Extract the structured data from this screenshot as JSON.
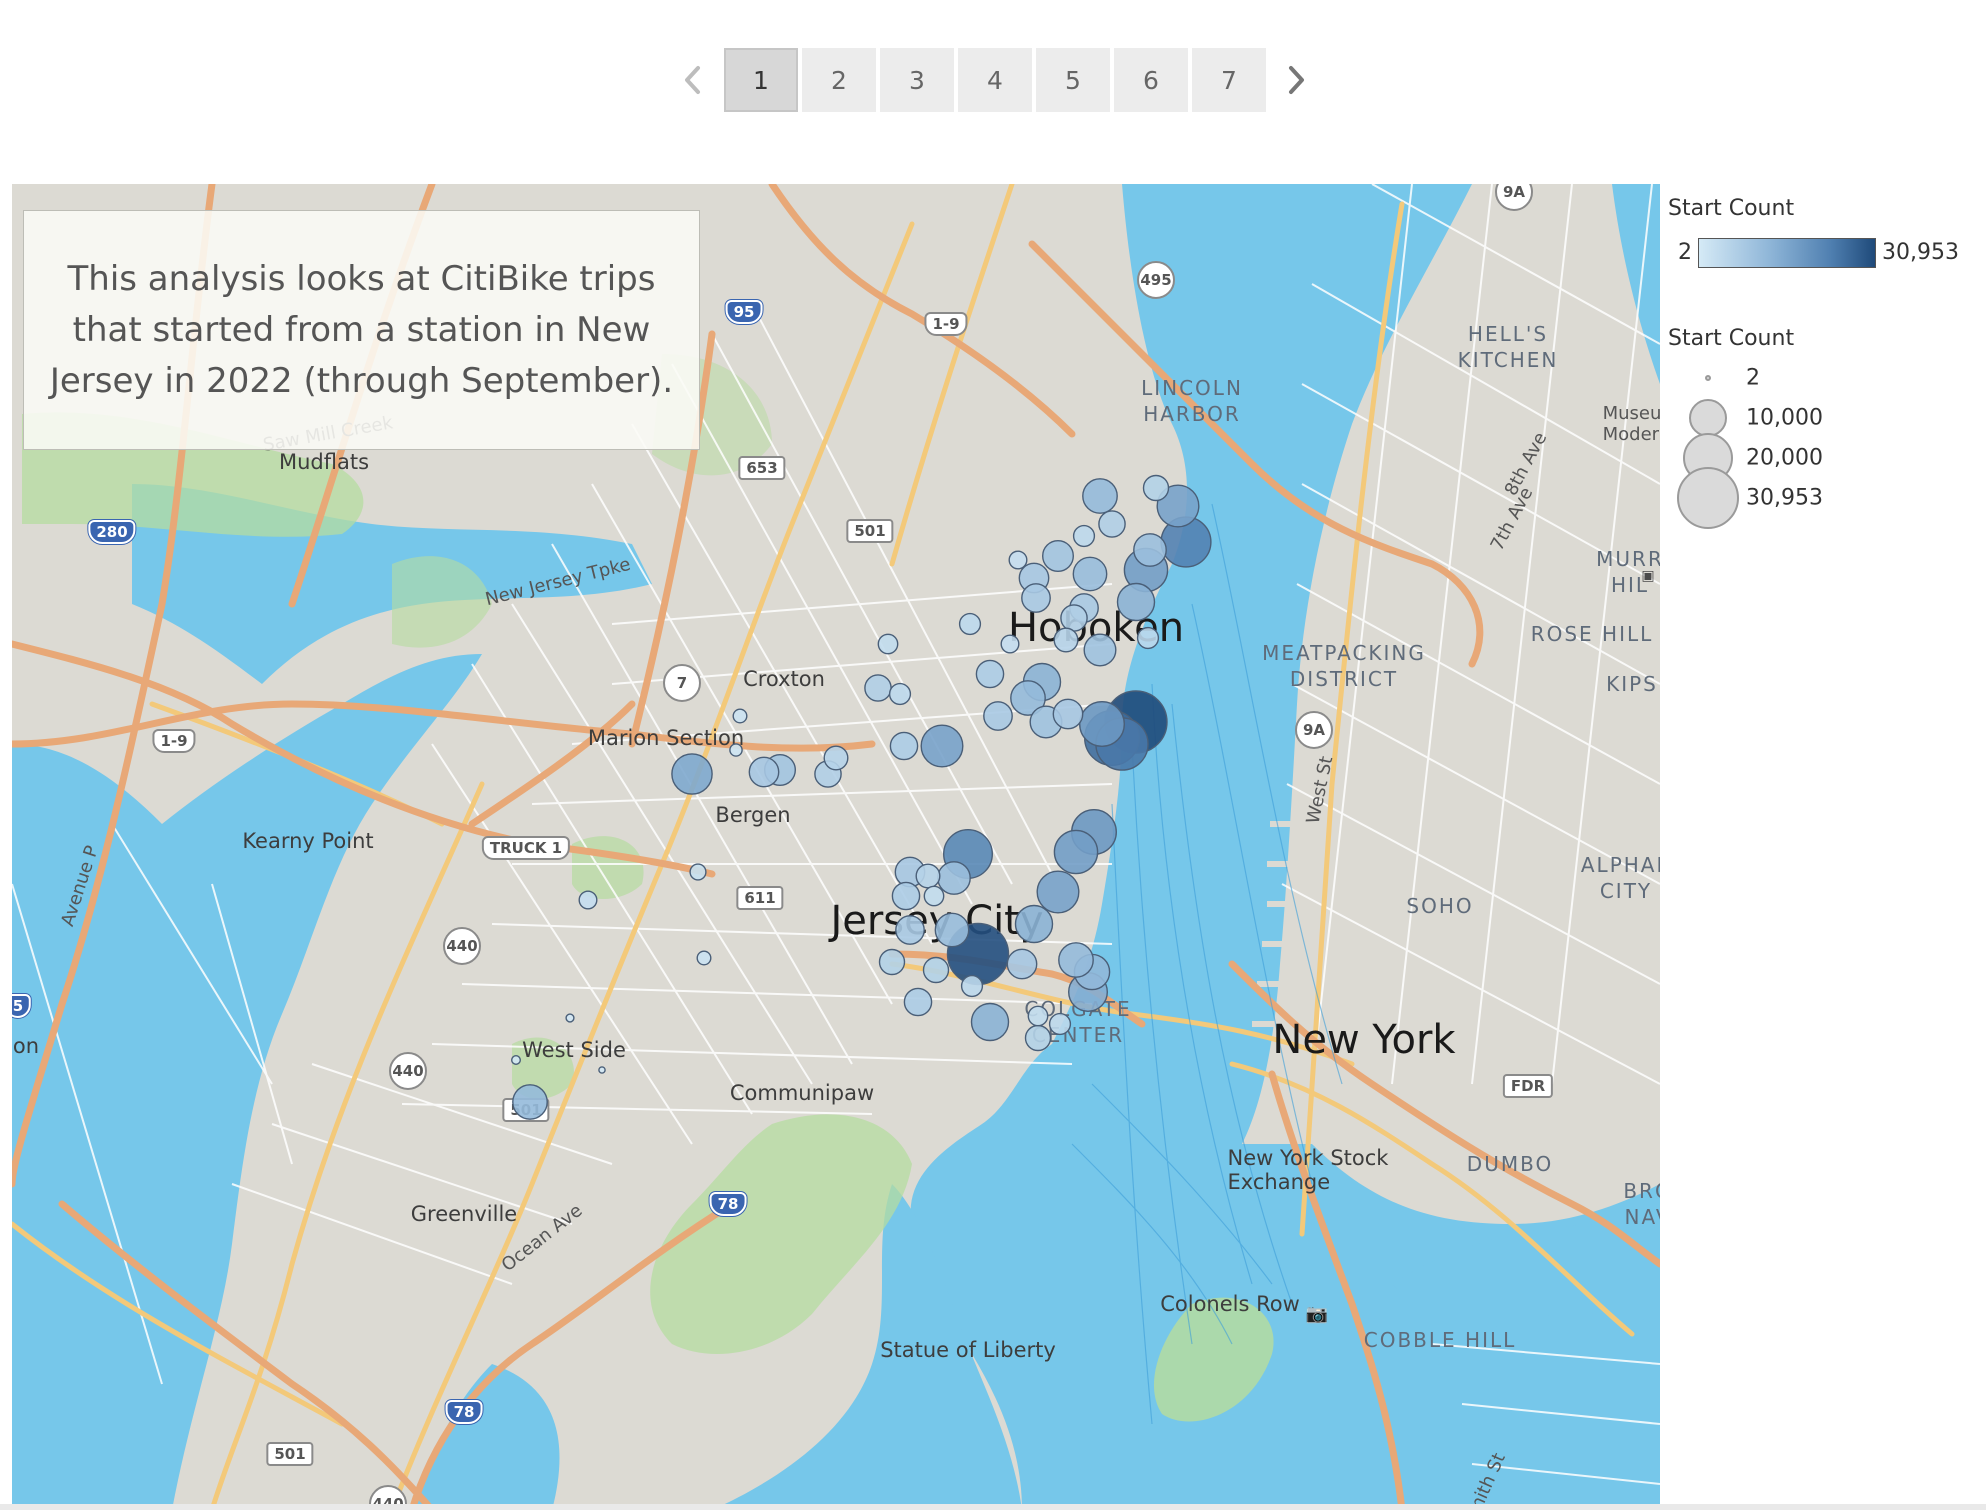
{
  "pager": {
    "prev_icon": "chevron-left-icon",
    "next_icon": "chevron-right-icon",
    "pages": [
      "1",
      "2",
      "3",
      "4",
      "5",
      "6",
      "7"
    ],
    "active_page": "1"
  },
  "annotation": {
    "text": "This analysis looks at CitiBike trips that started from a station in New Jersey in 2022 (through September)."
  },
  "legend_color": {
    "title": "Start Count",
    "min": "2",
    "max": "30,953",
    "colors": [
      "#d5eaf6",
      "#8fb6d8",
      "#4f7fb0",
      "#1f4a7a"
    ]
  },
  "legend_size": {
    "title": "Start Count",
    "items": [
      {
        "label": "2",
        "value": 2
      },
      {
        "label": "10,000",
        "value": 10000
      },
      {
        "label": "20,000",
        "value": 20000
      },
      {
        "label": "30,953",
        "value": 30953
      }
    ]
  },
  "map": {
    "colors": {
      "water": "#76c7ea",
      "land": "#dcdad3",
      "park": "#b5dca0",
      "road": "#ffffff",
      "highway": "#e8a877",
      "arterial": "#f3c97a"
    },
    "place_labels": [
      {
        "name": "saw-mill-creek-label",
        "text": "Saw Mill Creek",
        "cls": "lbl-street"
      },
      {
        "name": "mudflats-label",
        "text": "Mudflats",
        "cls": "lbl-place"
      },
      {
        "name": "lincoln-harbor-label",
        "text": "LINCOLN\nHARBOR",
        "cls": "lbl-district"
      },
      {
        "name": "hells-kitchen-label",
        "text": "HELL'S\nKITCHEN",
        "cls": "lbl-district"
      },
      {
        "name": "museum-modern-label",
        "text": "Museu\nModer",
        "cls": "lbl-street"
      },
      {
        "name": "8th-ave-label",
        "text": "8th Ave",
        "cls": "lbl-street"
      },
      {
        "name": "7th-ave-label",
        "text": "7th Ave",
        "cls": "lbl-street"
      },
      {
        "name": "murray-hill-label",
        "text": "MURR\nHIL",
        "cls": "lbl-district"
      },
      {
        "name": "rose-hill-label",
        "text": "ROSE HILL",
        "cls": "lbl-district"
      },
      {
        "name": "kips-label",
        "text": "KIPS",
        "cls": "lbl-district"
      },
      {
        "name": "meatpacking-label",
        "text": "MEATPACKING\nDISTRICT",
        "cls": "lbl-district"
      },
      {
        "name": "hoboken-label",
        "text": "Hoboken",
        "cls": "lbl-city"
      },
      {
        "name": "croxton-label",
        "text": "Croxton",
        "cls": "lbl-place"
      },
      {
        "name": "marion-section-label",
        "text": "Marion Section",
        "cls": "lbl-place"
      },
      {
        "name": "bergen-label",
        "text": "Bergen",
        "cls": "lbl-place"
      },
      {
        "name": "kearny-point-label",
        "text": "Kearny Point",
        "cls": "lbl-place"
      },
      {
        "name": "west-st-label",
        "text": "West St",
        "cls": "lbl-street"
      },
      {
        "name": "alphabet-city-label",
        "text": "ALPHAE\nCITY",
        "cls": "lbl-district"
      },
      {
        "name": "soho-label",
        "text": "SOHO",
        "cls": "lbl-district"
      },
      {
        "name": "jersey-city-label",
        "text": "Jersey City",
        "cls": "lbl-city"
      },
      {
        "name": "new-york-label",
        "text": "New York",
        "cls": "lbl-city"
      },
      {
        "name": "colgate-center-label",
        "text": "COLGATE\nCENTER",
        "cls": "lbl-district"
      },
      {
        "name": "west-side-label",
        "text": "West Side",
        "cls": "lbl-place"
      },
      {
        "name": "communipaw-label",
        "text": "Communipaw",
        "cls": "lbl-place"
      },
      {
        "name": "avenue-p-label",
        "text": "Avenue P",
        "cls": "lbl-street"
      },
      {
        "name": "nyse-label",
        "text": "New York Stock\nExchange",
        "cls": "lbl-place"
      },
      {
        "name": "dumbo-label",
        "text": "DUMBO",
        "cls": "lbl-district"
      },
      {
        "name": "bro-nav-label",
        "text": "BRO\nNAV",
        "cls": "lbl-district"
      },
      {
        "name": "greenville-label",
        "text": "Greenville",
        "cls": "lbl-place"
      },
      {
        "name": "ocean-ave-label",
        "text": "Ocean Ave",
        "cls": "lbl-street"
      },
      {
        "name": "colonels-row-label",
        "text": "Colonels Row",
        "cls": "lbl-place"
      },
      {
        "name": "cobble-hill-label",
        "text": "COBBLE HILL",
        "cls": "lbl-district"
      },
      {
        "name": "statue-of-liberty-label",
        "text": "Statue of Liberty",
        "cls": "lbl-place"
      },
      {
        "name": "smith-st-label",
        "text": "mith St",
        "cls": "lbl-street"
      },
      {
        "name": "on-label",
        "text": "on",
        "cls": "lbl-place"
      },
      {
        "name": "new-jersey-tpk-label",
        "text": "New Jersey Tpke",
        "cls": "lbl-street"
      }
    ],
    "shields": [
      {
        "name": "route-9a-shield-north",
        "text": "9A",
        "type": "round"
      },
      {
        "name": "route-495-shield",
        "text": "495",
        "type": "round"
      },
      {
        "name": "route-95-shield",
        "text": "95",
        "type": "interstate"
      },
      {
        "name": "route-1-9-shield-north",
        "text": "1-9",
        "type": "us"
      },
      {
        "name": "route-653-shield",
        "text": "653",
        "type": "plain"
      },
      {
        "name": "route-280-shield",
        "text": "280",
        "type": "interstate"
      },
      {
        "name": "route-501-shield-north",
        "text": "501",
        "type": "plain"
      },
      {
        "name": "route-7-shield",
        "text": "7",
        "type": "round"
      },
      {
        "name": "route-1-9-shield-west",
        "text": "1-9",
        "type": "us"
      },
      {
        "name": "route-9a-shield-south",
        "text": "9A",
        "type": "round"
      },
      {
        "name": "route-1-truck-shield",
        "text": "TRUCK 1",
        "type": "us"
      },
      {
        "name": "route-440-shield-north",
        "text": "440",
        "type": "round"
      },
      {
        "name": "route-611-shield",
        "text": "611",
        "type": "plain"
      },
      {
        "name": "route-440-shield-south",
        "text": "440",
        "type": "round"
      },
      {
        "name": "route-501-shield-mid",
        "text": "501",
        "type": "plain"
      },
      {
        "name": "fdr-shield",
        "text": "FDR",
        "type": "plain"
      },
      {
        "name": "route-78-shield-east",
        "text": "78",
        "type": "interstate"
      },
      {
        "name": "route-78-shield-south",
        "text": "78",
        "type": "interstate"
      },
      {
        "name": "route-501-shield-south",
        "text": "501",
        "type": "plain"
      },
      {
        "name": "route-440-shield-bottom",
        "text": "440",
        "type": "round"
      },
      {
        "name": "route-5-shield",
        "text": "5",
        "type": "interstate"
      }
    ],
    "stations_note": "Circle positions are map geography; start counts are estimates read from circle size/color.",
    "stations": [
      {
        "count": 9500
      },
      {
        "count": 5000
      },
      {
        "count": 14000
      },
      {
        "count": 20000
      },
      {
        "count": 5500
      },
      {
        "count": 3500
      },
      {
        "count": 8500
      },
      {
        "count": 15000
      },
      {
        "count": 7500
      },
      {
        "count": 2500
      },
      {
        "count": 7000
      },
      {
        "count": 6500
      },
      {
        "count": 9000
      },
      {
        "count": 11000
      },
      {
        "count": 3500
      },
      {
        "count": 6500
      },
      {
        "count": 2500
      },
      {
        "count": 5500
      },
      {
        "count": 4500
      },
      {
        "count": 3500
      },
      {
        "count": 8000
      },
      {
        "count": 6000
      },
      {
        "count": 9500
      },
      {
        "count": 11000
      },
      {
        "count": 3000
      },
      {
        "count": 8000
      },
      {
        "count": 6500
      },
      {
        "count": 7000
      },
      {
        "count": 16000
      },
      {
        "count": 22000
      },
      {
        "count": 30953
      },
      {
        "count": 24000
      },
      {
        "count": 1500
      },
      {
        "count": 14000
      },
      {
        "count": 3500
      },
      {
        "count": 1200
      },
      {
        "count": 5500
      },
      {
        "count": 4500
      },
      {
        "count": 7500
      },
      {
        "count": 7000
      },
      {
        "count": 5500
      },
      {
        "count": 6000
      },
      {
        "count": 16000
      },
      {
        "count": 15000
      },
      {
        "count": 19000
      },
      {
        "count": 7000
      },
      {
        "count": 4500
      },
      {
        "count": 8500
      },
      {
        "count": 14000
      },
      {
        "count": 6000
      },
      {
        "count": 3000
      },
      {
        "count": 11000
      },
      {
        "count": 6500
      },
      {
        "count": 9000
      },
      {
        "count": 30000
      },
      {
        "count": 9500
      },
      {
        "count": 7000
      },
      {
        "count": 5000
      },
      {
        "count": 5000
      },
      {
        "count": 12000
      },
      {
        "count": 6000
      },
      {
        "count": 3500
      },
      {
        "count": 3000
      },
      {
        "count": 3500
      },
      {
        "count": 5000
      },
      {
        "count": 11000
      },
      {
        "count": 10000
      },
      {
        "count": 13000
      },
      {
        "count": 2000
      },
      {
        "count": 2500
      },
      {
        "count": 1500
      },
      {
        "count": 500
      },
      {
        "count": 300
      },
      {
        "count": 600
      },
      {
        "count": 9500
      }
    ]
  }
}
